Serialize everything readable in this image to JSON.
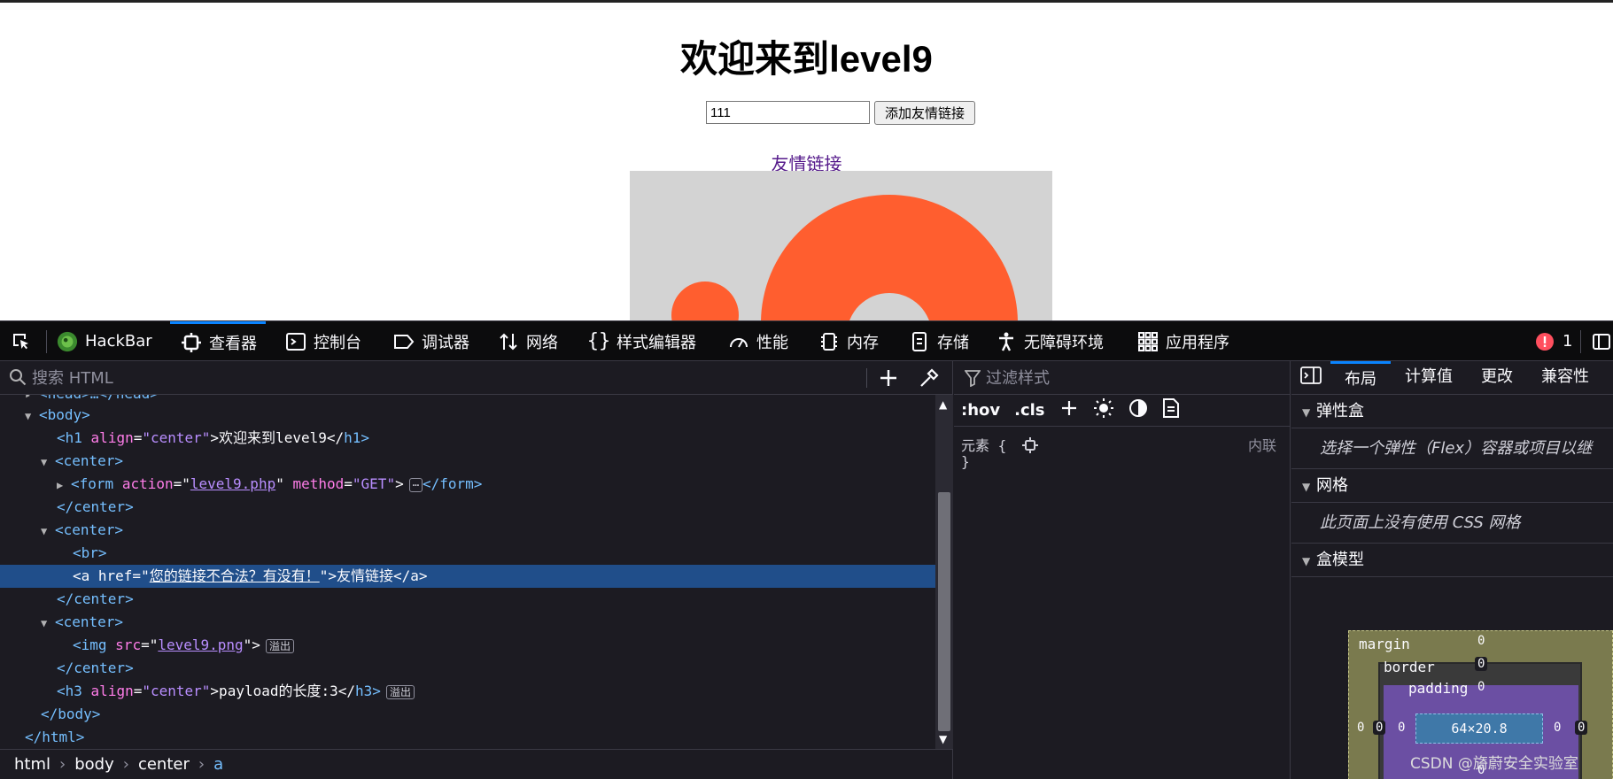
{
  "page": {
    "title": "欢迎来到level9",
    "input_value": "111",
    "submit_label": "添加友情链接",
    "link_text": "友情链接",
    "image_colors": {
      "background": "#d3d3d3",
      "shape": "#ff5e2f"
    }
  },
  "devtools": {
    "tabs": [
      {
        "label": "HackBar",
        "icon": "hackbar-icon"
      },
      {
        "label": "查看器",
        "icon": "inspector-icon",
        "active": true
      },
      {
        "label": "控制台",
        "icon": "console-icon"
      },
      {
        "label": "调试器",
        "icon": "debugger-icon"
      },
      {
        "label": "网络",
        "icon": "network-icon"
      },
      {
        "label": "样式编辑器",
        "icon": "style-editor-icon"
      },
      {
        "label": "性能",
        "icon": "performance-icon"
      },
      {
        "label": "内存",
        "icon": "memory-icon"
      },
      {
        "label": "存储",
        "icon": "storage-icon"
      },
      {
        "label": "无障碍环境",
        "icon": "accessibility-icon"
      },
      {
        "label": "应用程序",
        "icon": "application-icon"
      }
    ],
    "error_count": "1",
    "accent_color": "#0a84ff",
    "markup": {
      "search_placeholder": "搜索 HTML",
      "rows": {
        "head": "<head>…</head>",
        "body_open": "<body>",
        "h1_tag_open": "<h1",
        "h1_attr": "align",
        "h1_val": "\"center\"",
        "h1_text": ">欢迎来到level9</",
        "h1_close": "h1>",
        "center_open": "<center>",
        "center_close": "</center>",
        "form_open": "<form",
        "form_attr_action": "action",
        "form_val_action": "level9.php",
        "form_attr_method": "method",
        "form_val_method": "\"GET\"",
        "form_badge": "⋯",
        "form_close": "</form>",
        "br": "<br>",
        "a_open": "<a href=\"",
        "a_href": "您的链接不合法？有没有！",
        "a_after": "\">友情链接</a>",
        "img_open": "<img",
        "img_attr": "src",
        "img_val": "level9.png",
        "img_close": "\">",
        "overflow_badge": "溢出",
        "h3_open": "<h3",
        "h3_attr": "align",
        "h3_val": "\"center\"",
        "h3_text": ">payload的长度:3</",
        "h3_close": "h3>",
        "body_close": "</body>",
        "html_close": "</html>"
      },
      "breadcrumb": [
        "html",
        "body",
        "center",
        "a"
      ]
    },
    "rules": {
      "filter_placeholder": "过滤样式",
      "hov": ":hov",
      "cls": ".cls",
      "element_label": "元素 {",
      "element_close": "}",
      "inline_label": "内联"
    },
    "layout": {
      "tabs": [
        "布局",
        "计算值",
        "更改",
        "兼容性"
      ],
      "flexbox_title": "弹性盒",
      "flexbox_hint": "选择一个弹性（Flex）容器或项目以继",
      "grid_title": "网格",
      "grid_hint": "此页面上没有使用 CSS 网格",
      "boxmodel_title": "盒模型",
      "boxmodel": {
        "margin_label": "margin",
        "border_label": "border",
        "padding_label": "padding",
        "content_size": "64×20.8",
        "zero": "0"
      }
    }
  },
  "watermark": "CSDN @旖蔚安全实验室"
}
